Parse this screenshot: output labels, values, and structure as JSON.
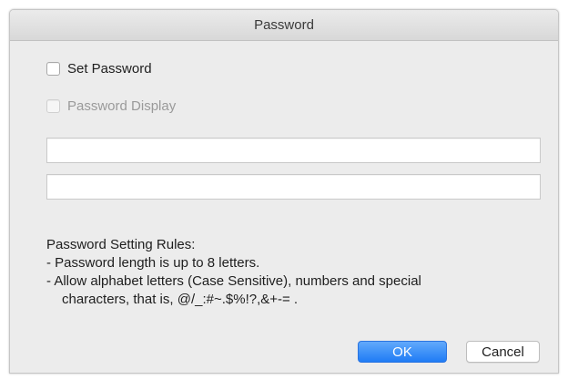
{
  "window": {
    "title": "Password"
  },
  "options": {
    "set_password": {
      "label": "Set Password",
      "checked": false,
      "enabled": true
    },
    "password_display": {
      "label": "Password Display",
      "checked": false,
      "enabled": false
    }
  },
  "fields": {
    "password": {
      "value": "",
      "placeholder": ""
    },
    "confirm_password": {
      "value": "",
      "placeholder": ""
    }
  },
  "rules": {
    "heading": "Password Setting Rules:",
    "line1": "- Password length is up to 8 letters.",
    "line2": "- Allow alphabet letters (Case Sensitive), numbers and special",
    "line3": "characters, that is, @/_:#~.$%!?,&+-= ."
  },
  "buttons": {
    "ok": "OK",
    "cancel": "Cancel"
  },
  "colors": {
    "accent": "#1f7cf5",
    "window_bg": "#ececec"
  }
}
